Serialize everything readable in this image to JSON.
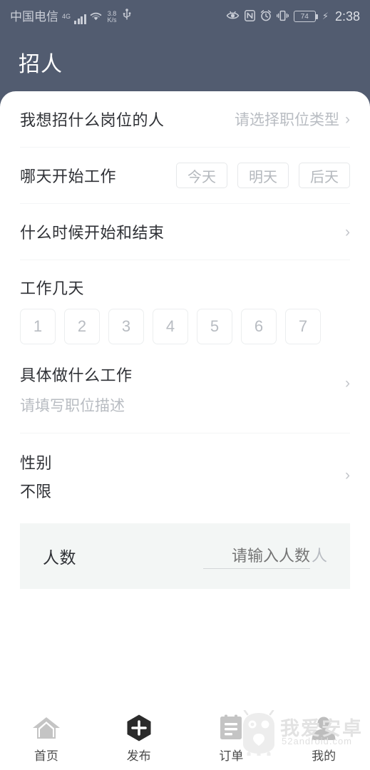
{
  "statusbar": {
    "carrier": "中国电信",
    "network": "4G",
    "speed_value": "3.8",
    "speed_unit": "K/s",
    "usb_icon": "usb-icon",
    "signal_icon": "signal-bars-icon",
    "wifi_icon": "wifi-icon",
    "eye_icon": "eye-icon",
    "nfc_icon": "nfc-icon",
    "alarm_icon": "alarm-clock-icon",
    "vibrate_icon": "vibrate-icon",
    "battery_level": "74",
    "charging_icon": "charging-bolt-icon",
    "time": "2:38"
  },
  "header": {
    "title": "招人"
  },
  "form": {
    "position": {
      "label": "我想招什么岗位的人",
      "placeholder": "请选择职位类型",
      "chevron": "›"
    },
    "start_day": {
      "label": "哪天开始工作",
      "chips": [
        "今天",
        "明天",
        "后天"
      ]
    },
    "time_range": {
      "label": "什么时候开始和结束",
      "chevron": "›"
    },
    "work_days": {
      "label": "工作几天",
      "options": [
        "1",
        "2",
        "3",
        "4",
        "5",
        "6",
        "7"
      ]
    },
    "job_desc": {
      "label": "具体做什么工作",
      "placeholder": "请填写职位描述",
      "chevron": "›"
    },
    "gender": {
      "label": "性别",
      "value": "不限",
      "chevron": "›"
    },
    "count": {
      "label": "人数",
      "placeholder": "请输入人数",
      "value": "",
      "unit": "人"
    }
  },
  "tabbar": {
    "items": [
      {
        "label": "首页",
        "icon": "home-icon"
      },
      {
        "label": "发布",
        "icon": "publish-plus-icon"
      },
      {
        "label": "订单",
        "icon": "orders-clipboard-icon"
      },
      {
        "label": "我的",
        "icon": "profile-person-icon"
      }
    ]
  },
  "watermark": {
    "text": "我爱安卓",
    "sub": "52android.com",
    "logo": "android-robot-icon"
  },
  "colors": {
    "header_bg": "#525c70",
    "card_bg": "#ffffff",
    "label": "#2f3136",
    "placeholder": "#b8bcc2",
    "subcard_bg": "#f3f6f5",
    "border": "#e6e8ea"
  }
}
